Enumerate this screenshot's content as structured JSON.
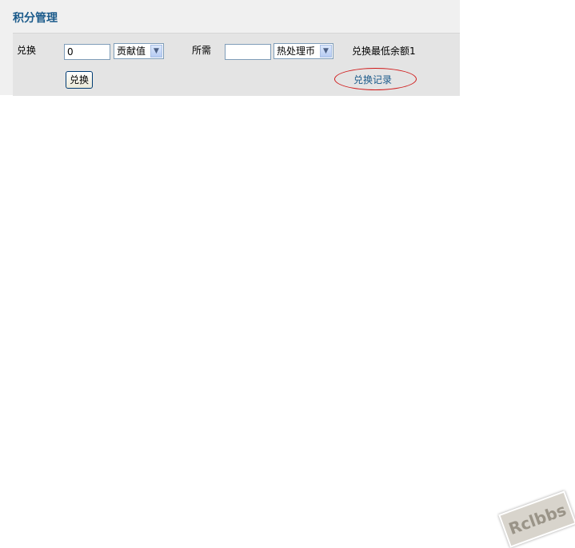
{
  "panel": {
    "title": "积分管理"
  },
  "exchange": {
    "label": "兑换",
    "amount_value": "0",
    "from_currency": "贡献值",
    "required_label": "所需",
    "required_value": "",
    "to_currency": "热处理币",
    "min_note": "兑换最低余额1",
    "submit_label": "兑换",
    "records_link": "兑换记录"
  },
  "watermark": "Rclbbs"
}
